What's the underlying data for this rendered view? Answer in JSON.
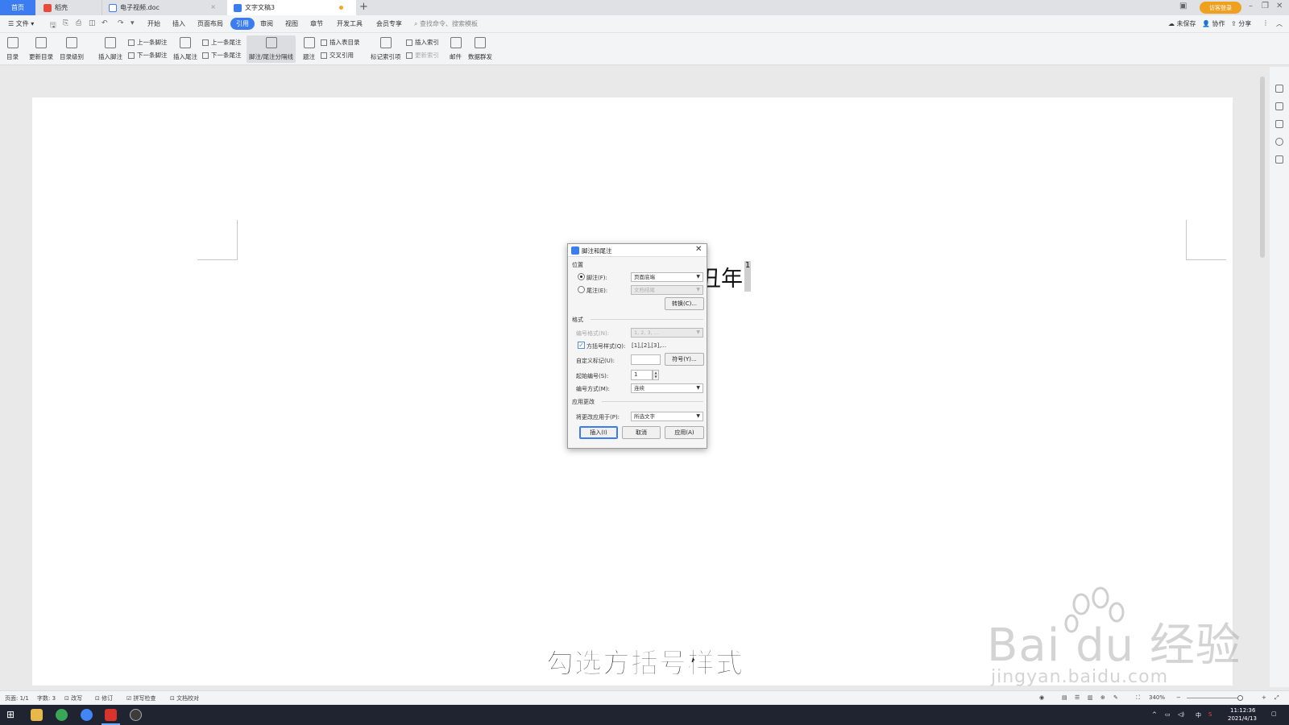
{
  "tabs": {
    "home": "首页",
    "t1": "稻壳",
    "t2": "电子视频.doc",
    "t3": "文字文稿3"
  },
  "titlebar": {
    "login": "访客登录"
  },
  "menubar": {
    "file": "文件",
    "items": [
      "开始",
      "插入",
      "页面布局",
      "引用",
      "审阅",
      "视图",
      "章节",
      "开发工具",
      "会员专享"
    ],
    "active": "引用",
    "search_placeholder": "查找命令、搜索模板",
    "unsaved": "未保存",
    "collab": "协作",
    "share": "分享"
  },
  "ribbon": {
    "toc": "目录",
    "update_toc": "更新目录",
    "toc_level": "目录级别",
    "insert_footnote": "插入脚注",
    "prev_footnote": "上一条脚注",
    "next_footnote": "下一条脚注",
    "insert_endnote": "插入尾注",
    "prev_endnote": "上一条尾注",
    "next_endnote": "下一条尾注",
    "separator": "脚注/尾注分隔线",
    "caption": "题注",
    "insert_table_toc": "插入表目录",
    "cross_ref": "交叉引用",
    "mark_index": "标记索引项",
    "insert_index": "插入索引",
    "update_index": "更新索引",
    "mail": "邮件",
    "data_dist": "数据群发"
  },
  "document": {
    "text": "丑年",
    "mark": "1"
  },
  "dialog": {
    "title": "脚注和尾注",
    "position_section": "位置",
    "footnote_label": "脚注(F):",
    "footnote_value": "页面底端",
    "endnote_label": "尾注(E):",
    "endnote_value": "文档结尾",
    "convert_btn": "转换(C)...",
    "format_section": "格式",
    "number_format_label": "编号格式(N):",
    "number_format_value": "1, 2, 3, ...",
    "bracket_label": "方括号样式(Q):",
    "bracket_example": "[1],[2],[3],...",
    "custom_mark_label": "自定义标记(U):",
    "custom_mark_value": "",
    "symbol_btn": "符号(Y)...",
    "start_label": "起始编号(S):",
    "start_value": "1",
    "numbering_label": "编号方式(M):",
    "numbering_value": "连续",
    "apply_section": "应用更改",
    "apply_to_label": "将更改应用于(P):",
    "apply_to_value": "所选文字",
    "insert_btn": "插入(I)",
    "cancel_btn": "取消",
    "apply_btn": "应用(A)"
  },
  "overlay": {
    "subtitle": "勾选方括号样式",
    "watermark_brand": "Bai du 经验",
    "watermark_url": "jingyan.baidu.com"
  },
  "statusbar": {
    "page": "页面: 1/1",
    "words": "字数: 3",
    "rewrite": "改写",
    "revise": "修订",
    "spell": "拼写检查",
    "proof": "文档校对",
    "zoom": "340%"
  },
  "taskbar": {
    "time": "11:12:36",
    "date": "2021/4/13",
    "ime": "中"
  },
  "colors": {
    "accent": "#3b7df0",
    "login": "#f0a020",
    "taskbar": "#1f2430"
  }
}
